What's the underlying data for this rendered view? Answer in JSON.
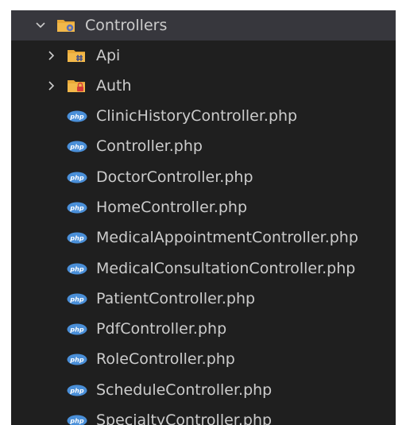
{
  "explorer": {
    "root": {
      "label": "Controllers",
      "expanded": true,
      "icon": "controllers-folder-icon"
    },
    "folders": [
      {
        "label": "Api",
        "expanded": false,
        "icon": "api-folder-icon"
      },
      {
        "label": "Auth",
        "expanded": false,
        "icon": "auth-folder-icon"
      }
    ],
    "files": [
      {
        "label": "ClinicHistoryController.php"
      },
      {
        "label": "Controller.php"
      },
      {
        "label": "DoctorController.php"
      },
      {
        "label": "HomeController.php"
      },
      {
        "label": "MedicalAppointmentController.php"
      },
      {
        "label": "MedicalConsultationController.php"
      },
      {
        "label": "PatientController.php"
      },
      {
        "label": "PdfController.php"
      },
      {
        "label": "RoleController.php"
      },
      {
        "label": "ScheduleController.php"
      },
      {
        "label": "SpecialtyController.php"
      }
    ],
    "file_icon": "php-file-icon",
    "colors": {
      "background": "#1f1f1f",
      "selected_row": "#37373d",
      "text": "#cccccc",
      "folder": "#e8a838",
      "php_badge": "#4a8fd8"
    }
  }
}
